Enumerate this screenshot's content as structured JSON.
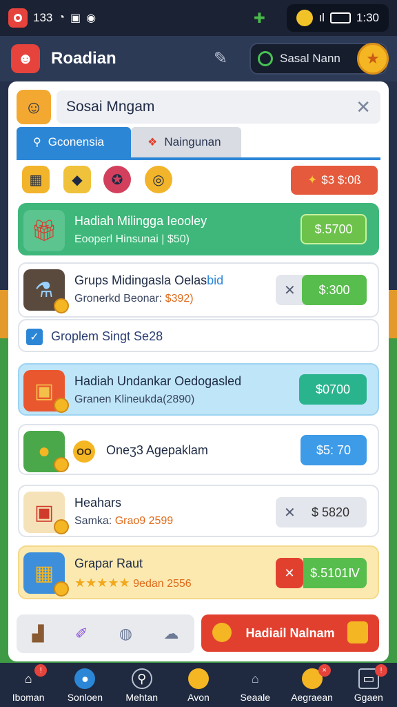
{
  "status": {
    "time_left": "133",
    "time_right": "1:30"
  },
  "appbar": {
    "title": "Roadian",
    "search_label": "Sasal Nann"
  },
  "panel": {
    "title": "Sosai Mngam",
    "tabs": [
      {
        "label": "Gconensia"
      },
      {
        "label": "Naingunan"
      }
    ],
    "top_price": "$3 $:0ß",
    "cards": [
      {
        "title": "Hadiah Milingga Ieooley",
        "sub": "Eooperl Hinsunai | $50)",
        "price": "$.5700"
      },
      {
        "title": "Grups Midingasla Oelas",
        "title_acc": "bid",
        "sub_a": "Gronerkd Beonar: ",
        "sub_b": "$392)",
        "price": "$:300"
      },
      {
        "checkbox_label": "Groplem Singt Se28"
      },
      {
        "title": "Hadiah Undankar Oedogasled",
        "sub": "Granen Klineukda(2890)",
        "price": "$0700"
      },
      {
        "title": "Oneʒ3 Agepaklam",
        "badge": "OO",
        "price": "$5: 70"
      },
      {
        "title": "Heahars",
        "sub_a": "Samka: ",
        "sub_b": "Grao9 2599",
        "price": "$ 5820"
      },
      {
        "title": "Grapar Raut",
        "sub_b": "9edan 2556",
        "price": "$.5101Ⅳ"
      }
    ],
    "cta_label": "Hadiail Nalnam"
  },
  "nav": {
    "items": [
      {
        "label": "Iboman"
      },
      {
        "label": "Sonloen"
      },
      {
        "label": "Mehtan"
      },
      {
        "label": "Avon"
      },
      {
        "label": "Seaale"
      },
      {
        "label": "Aegraean"
      },
      {
        "label": "Ggaen"
      }
    ]
  },
  "colors": {
    "accent_blue": "#2c86d6",
    "green": "#47c154",
    "red": "#e55a3c",
    "coin": "#f4b623"
  }
}
